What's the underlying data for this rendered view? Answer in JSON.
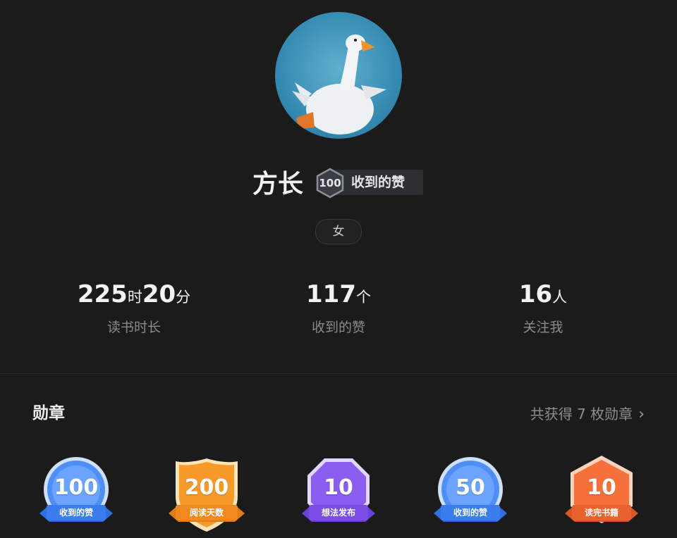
{
  "profile": {
    "name": "方长",
    "badge_number": "100",
    "badge_text": "收到的赞",
    "gender": "女"
  },
  "stats": [
    {
      "value1": "225",
      "unit1": "时",
      "value2": "20",
      "unit2": "分",
      "label": "读书时长"
    },
    {
      "value1": "117",
      "unit1": "个",
      "value2": "",
      "unit2": "",
      "label": "收到的赞"
    },
    {
      "value1": "16",
      "unit1": "人",
      "value2": "",
      "unit2": "",
      "label": "关注我"
    }
  ],
  "medals_section": {
    "title": "勋章",
    "summary": "共获得 7 枚勋章",
    "chevron": "›",
    "items": [
      {
        "number": "100",
        "label": "收到的赞",
        "color": "#4e8ef7",
        "shape": "circle"
      },
      {
        "number": "200",
        "label": "阅读天数",
        "color": "#f79a2a",
        "shape": "shield"
      },
      {
        "number": "10",
        "label": "想法发布",
        "color": "#8a5cf0",
        "shape": "octagon"
      },
      {
        "number": "50",
        "label": "收到的赞",
        "color": "#4e8ef7",
        "shape": "circle"
      },
      {
        "number": "10",
        "label": "读完书籍",
        "color": "#f4713c",
        "shape": "hexagon"
      }
    ]
  },
  "colors": {
    "background": "#1b1b1b",
    "text_primary": "#f3f3f3",
    "text_secondary": "#8a8a8a"
  }
}
